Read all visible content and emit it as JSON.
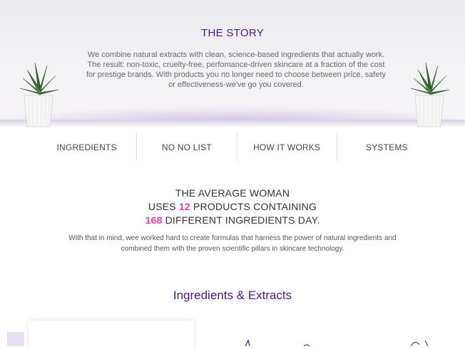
{
  "hero": {
    "title": "THE STORY",
    "text": "We combine natural extracts with clean, science-based ingredients that actually work. The result: non-toxic, cruelty-free, perfomance-driven skincare at a fraction of the cost for prestige brands. With products you no longer need to choose between price, safety or effectiveness-we've go you covered."
  },
  "nav": {
    "items": [
      "INGREDIENTS",
      "NO NO LIST",
      "HOW IT WORKS",
      "SYSTEMS"
    ]
  },
  "stats": {
    "line1": "THE AVERAGE WOMAN",
    "line2_pre": "USES ",
    "line2_num": "12",
    "line2_post": " PRODUCTS CONTAINING",
    "line3_num": "168",
    "line3_post": " DIFFERENT INGREDIENTS DAY.",
    "description": "With that in mind, wee worked hard to create formulas that harness the power of natural ingredients and combined them with the proven scientific pillars in skincare technology."
  },
  "section": {
    "title": "Ingredients & Extracts"
  },
  "colors": {
    "title_purple": "#4a1a7a",
    "accent_pink": "#e040a8"
  }
}
